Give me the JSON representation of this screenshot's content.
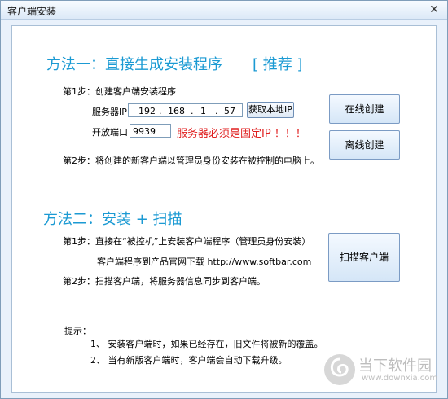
{
  "window": {
    "title": "客户端安装",
    "close": "✕"
  },
  "method1": {
    "heading": "方法一：直接生成安装程序",
    "tag": "[ 推荐 ]",
    "step1": "第1步：创建客户端安装程序",
    "server_ip_label": "服务器IP",
    "ip": [
      "192",
      "168",
      "1",
      "57"
    ],
    "ip_dot": ".",
    "get_local_ip": "获取本地IP",
    "port_label": "开放端口",
    "port_value": "9939",
    "warning": "服务器必须是固定IP ！！！",
    "online_btn": "在线创建",
    "offline_btn": "离线创建",
    "step2": "第2步：将创建的新客户端以管理员身份安装在被控制的电脑上。"
  },
  "method2": {
    "heading": "方法二：安装 + 扫描",
    "step1": "第1步：直接在“被控机”上安装客户端程序（管理员身份安装）",
    "download": "客户端程序到产品官网下载 http://www.softbar.com",
    "step2": "第2步：扫描客户端，将服务器信息同步到客户端。",
    "scan_btn": "扫描客户端"
  },
  "tips": {
    "title": "提示：",
    "items": [
      "1、  安装客户端时，如果已经存在，旧文件将被新的覆盖。",
      "2、  当有新版客户端时，客户端会自动下载升级。"
    ]
  },
  "watermark": {
    "brand": "当下软件园",
    "url": "www.downxia.com"
  }
}
